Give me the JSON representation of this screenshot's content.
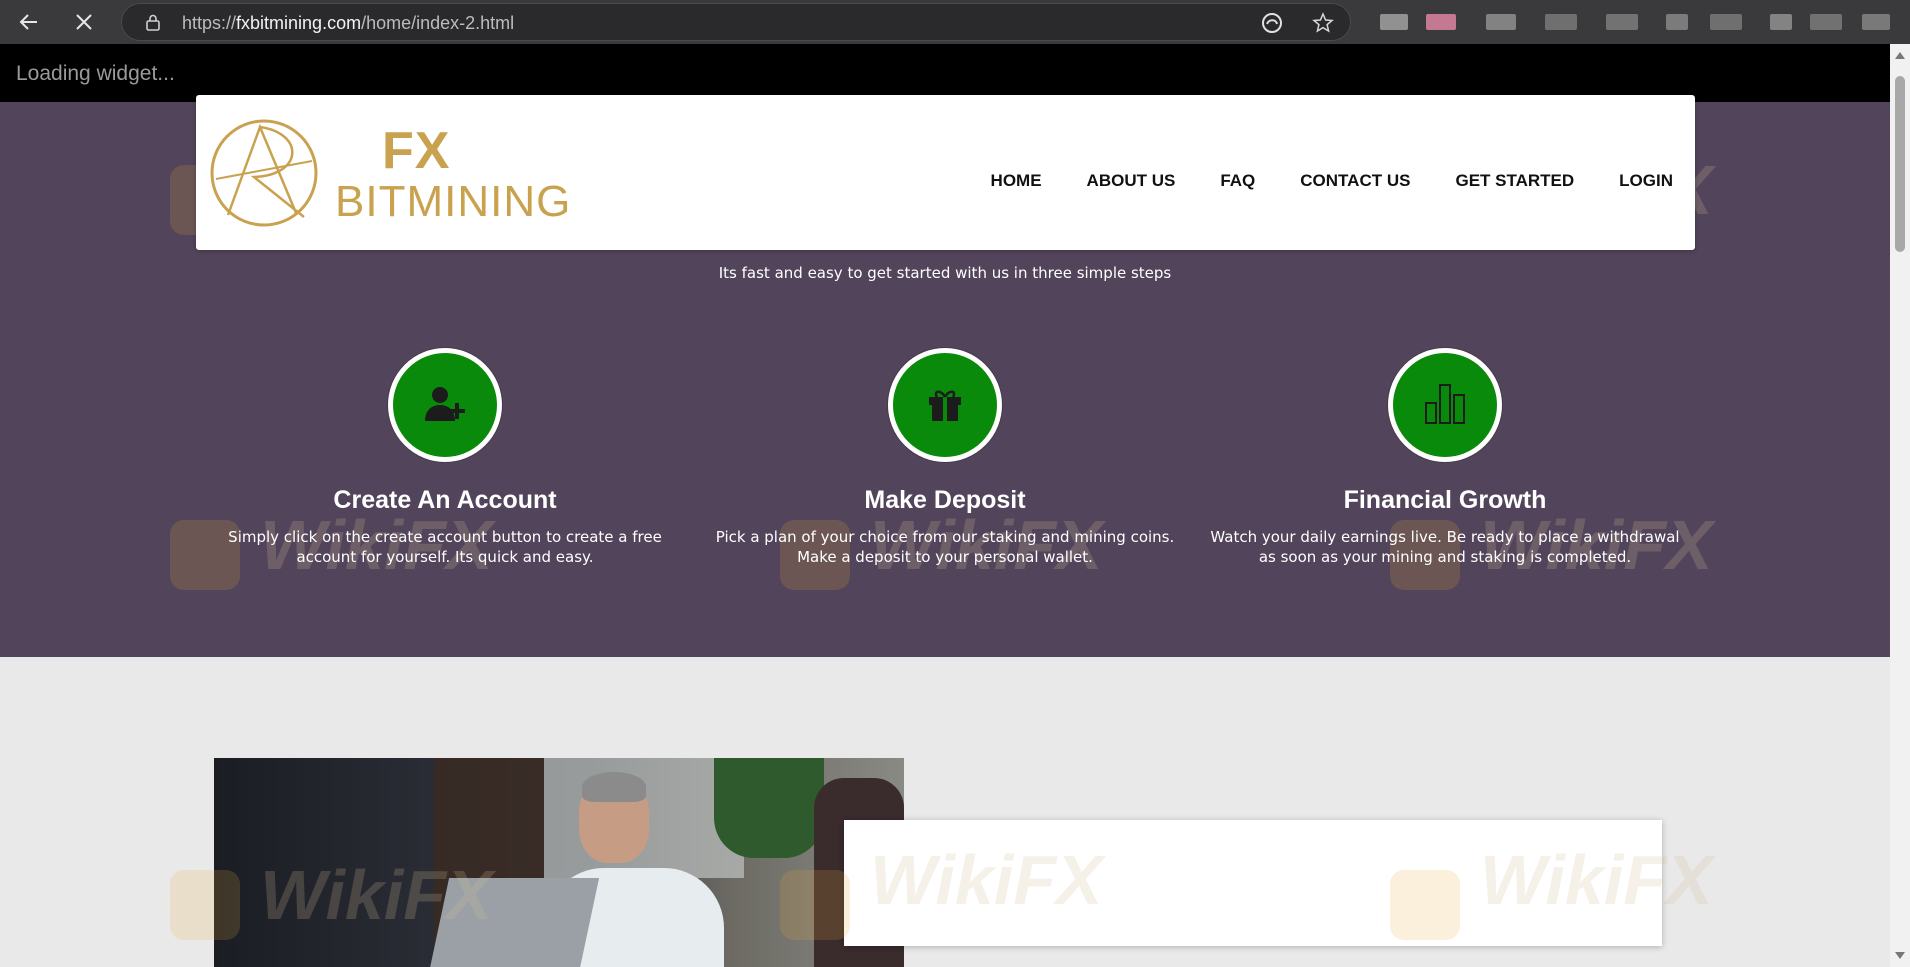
{
  "browser": {
    "url_prefix": "https://",
    "url_host": "fxbitmining.com",
    "url_path": "/home/index-2.html",
    "back_icon": "arrow-left-icon",
    "stop_icon": "close-icon"
  },
  "widget": {
    "text": "Loading widget..."
  },
  "header": {
    "logo_fx": "FX",
    "logo_name": "BITMINING",
    "nav": [
      {
        "label": "HOME"
      },
      {
        "label": "ABOUT US"
      },
      {
        "label": "FAQ"
      },
      {
        "label": "CONTACT US"
      },
      {
        "label": "GET STARTED"
      },
      {
        "label": "LOGIN"
      }
    ]
  },
  "hero": {
    "tagline": "Its fast and easy to get started with us in three simple steps",
    "steps": [
      {
        "title": "Create An Account",
        "text": "Simply click on the create account button to create a free account for yourself. Its quick and easy.",
        "icon": "add-user-icon"
      },
      {
        "title": "Make Deposit",
        "text": "Pick a plan of your choice from our staking and mining coins. Make a deposit to your personal wallet.",
        "icon": "gift-icon"
      },
      {
        "title": "Financial Growth",
        "text": "Watch your daily earnings live. Be ready to place a withdrawal as soon as your mining and staking is completed.",
        "icon": "bar-chart-icon"
      }
    ]
  },
  "watermark": "WikiFX",
  "colors": {
    "hero_bg": "#52445a",
    "step_circle": "#0a8a0a",
    "logo_gold": "#c9a24f"
  }
}
